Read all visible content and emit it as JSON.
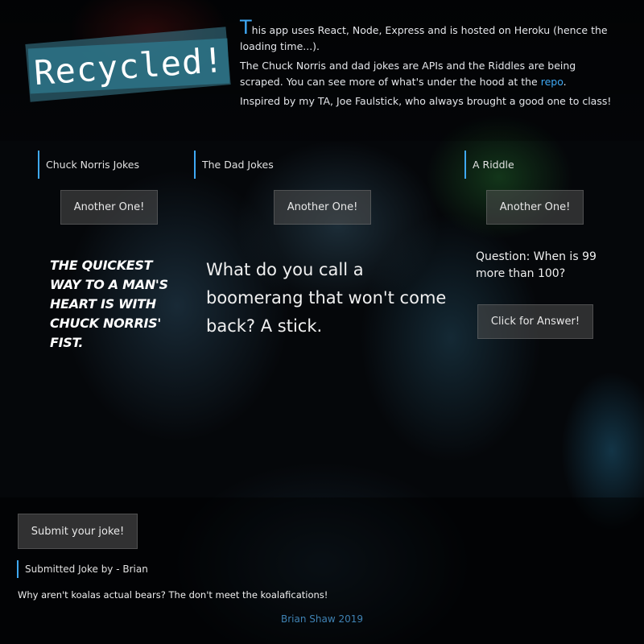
{
  "logo": {
    "text": "Recycled!"
  },
  "intro": {
    "dropcap": "T",
    "line1": "his app uses React, Node, Express and is hosted on Heroku (hence the loading time...).",
    "line2_prefix": "The Chuck Norris and dad jokes are APIs and the Riddles are being scraped. You can see more of what's under the hood at the ",
    "repo_link": "repo",
    "line2_suffix": ".",
    "line3": "Inspired by my TA, Joe Faulstick, who always brought a good one to class!"
  },
  "sections": {
    "chuck": {
      "title": "Chuck Norris Jokes",
      "button": "Another One!",
      "joke": "The quickest way to a man's heart is with Chuck Norris' fist."
    },
    "dad": {
      "title": "The Dad Jokes",
      "button": "Another One!",
      "joke": "What do you call a boomerang that won't come back? A stick."
    },
    "riddle": {
      "title": "A Riddle",
      "button": "Another One!",
      "question": "Question: When is 99 more than 100?",
      "answer_button": "Click for Answer!"
    }
  },
  "submit": {
    "button": "Submit your joke!",
    "submitted_title": "Submitted Joke by - Brian",
    "submitted_joke": "Why aren't koalas actual bears? The don't meet the koalafications!"
  },
  "footer": {
    "text": "Brian Shaw 2019"
  },
  "colors": {
    "accent": "#3fa9f5",
    "logo_bg": "#2d7387",
    "footer": "#3f82b3"
  }
}
